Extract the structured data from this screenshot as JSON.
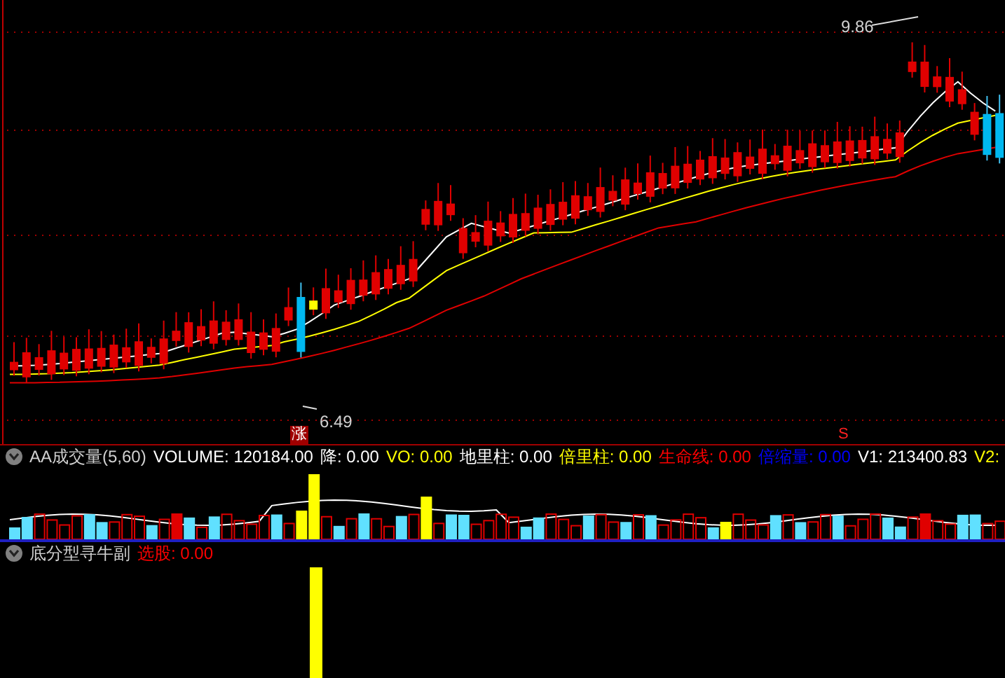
{
  "main_chart": {
    "high_label": "9.86",
    "low_label": "6.49",
    "markers": [
      {
        "kind": "rise",
        "text": "涨"
      },
      {
        "kind": "sell",
        "text": "S"
      }
    ]
  },
  "volume_panel": {
    "title": "AA成交量(5,60)",
    "fields": [
      {
        "text": "VOLUME: 120184.00",
        "color": "#ffffff"
      },
      {
        "text": "降: 0.00",
        "color": "#ffffff"
      },
      {
        "text": "VO: 0.00",
        "color": "#ffff00"
      },
      {
        "text": "地里柱: 0.00",
        "color": "#ffffff"
      },
      {
        "text": "倍里柱: 0.00",
        "color": "#ffff00"
      },
      {
        "text": "生命线: 0.00",
        "color": "#ff0000"
      },
      {
        "text": "倍缩量: 0.00",
        "color": "#0000ff"
      },
      {
        "text": "V1: 213400.83",
        "color": "#ffffff"
      },
      {
        "text": "V2:",
        "color": "#ffff00"
      }
    ]
  },
  "signal_panel": {
    "title": "底分型寻牛副",
    "fields": [
      {
        "text": "选股: 0.00",
        "color": "#ff0000"
      }
    ]
  }
}
